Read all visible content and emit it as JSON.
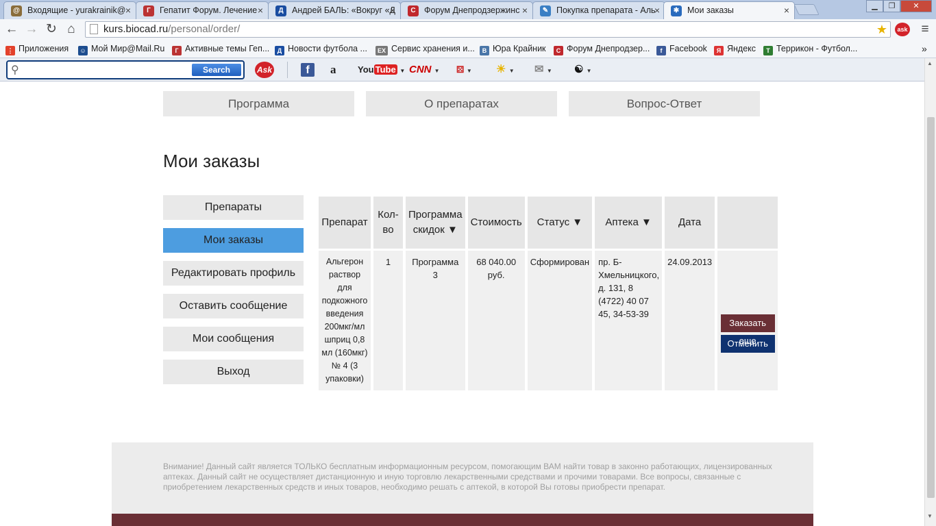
{
  "browser": {
    "tabs": [
      {
        "title": "Входящие - yurakrainik@",
        "icon": "mail-icon",
        "color": "#8a6d3b",
        "glyph": "@"
      },
      {
        "title": "Гепатит Форум. Лечение",
        "icon": "forum-icon",
        "color": "#b33",
        "glyph": "Г"
      },
      {
        "title": "Андрей БАЛЬ: «Вокруг «Д",
        "icon": "dynamo-icon",
        "color": "#1a4da1",
        "glyph": "Д"
      },
      {
        "title": "Форум Днепродзержинс",
        "icon": "c-icon",
        "color": "#c0282d",
        "glyph": "С"
      },
      {
        "title": "Покупка препарата - Аль",
        "icon": "wand-icon",
        "color": "#3a7fc4",
        "glyph": "✎"
      },
      {
        "title": "Мои заказы",
        "icon": "biocad-icon",
        "color": "#2a6bbd",
        "glyph": "✱"
      }
    ],
    "url_host": "kurs.biocad.ru",
    "url_path": "/personal/order/",
    "bookmarks": [
      {
        "label": "Приложения",
        "icon": "apps-icon",
        "color": "#e3412b",
        "glyph": "⋮"
      },
      {
        "label": "Мой Мир@Mail.Ru",
        "icon": "mailru-icon",
        "color": "#1d4d8f",
        "glyph": "☺"
      },
      {
        "label": "Активные темы Геп...",
        "icon": "forum-icon",
        "color": "#b33",
        "glyph": "Г"
      },
      {
        "label": "Новости футбола ...",
        "icon": "dynamo-icon",
        "color": "#1a4da1",
        "glyph": "Д"
      },
      {
        "label": "Сервис хранения и...",
        "icon": "ex-icon",
        "color": "#777",
        "glyph": "EX"
      },
      {
        "label": "Юра Крайник",
        "icon": "vk-icon",
        "color": "#4a76a8",
        "glyph": "B"
      },
      {
        "label": "Форум Днепродзер...",
        "icon": "c-icon",
        "color": "#c0282d",
        "glyph": "С"
      },
      {
        "label": "Facebook",
        "icon": "facebook-icon",
        "color": "#3b5998",
        "glyph": "f"
      },
      {
        "label": "Яндекс",
        "icon": "yandex-icon",
        "color": "#d33",
        "glyph": "Я"
      },
      {
        "label": "Террикон - Футбол...",
        "icon": "terrikon-icon",
        "color": "#2f7d32",
        "glyph": "T"
      }
    ],
    "ask_search_label": "Search",
    "ask_logo": "Ask"
  },
  "site": {
    "topnav": [
      "Программа",
      "О препаратах",
      "Вопрос-Ответ"
    ],
    "page_title": "Мои заказы",
    "sidebar": [
      "Препараты",
      "Мои заказы",
      "Редактировать профиль",
      "Оставить сообщение",
      "Мои сообщения",
      "Выход"
    ],
    "active_sidebar": "Мои заказы",
    "accent": "#4d9de0",
    "table": {
      "headers": [
        "Препарат",
        "Кол-во",
        "Программа скидок ▼",
        "Стоимость",
        "Статус ▼",
        "Аптека ▼",
        "Дата",
        ""
      ],
      "rows": [
        {
          "drug": "Альгерон раствор для подкожного введения 200мкг/мл шприц 0,8 мл (160мкг) № 4 (3 упаковки)",
          "qty": "1",
          "program": "Программа 3",
          "price": "68 040.00 руб.",
          "status": "Сформирован",
          "pharmacy": "пр. Б-Хмельницкого, д. 131, 8 (4722) 40 07 45, 34-53-39",
          "date": "24.09.2013",
          "btn_reorder": "Заказать еще",
          "btn_cancel": "Отменить"
        }
      ]
    },
    "disclaimer": "Внимание! Данный сайт является ТОЛЬКО бесплатным информационным ресурсом, помогающим ВАМ найти товар в законно работающих, лицензированных аптеках. Данный сайт не осуществляет дистанционную и иную торговлю лекарственными средствами и прочими товарами. Все вопросы, связанные с приобретением лекарственных средств и иных товаров, необходимо решать с аптекой, в которой Вы готовы приобрести препарат."
  }
}
